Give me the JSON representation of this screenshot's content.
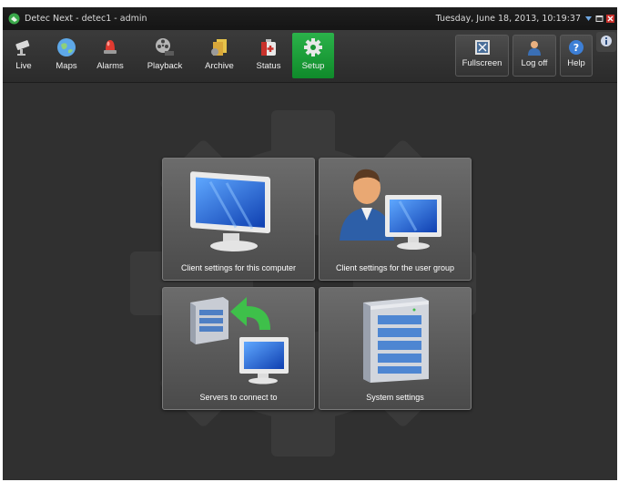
{
  "titlebar": {
    "title": "Detec Next - detec1 - admin",
    "datetime": "Tuesday, June 18, 2013, 10:19:37"
  },
  "toolbar": {
    "nav": [
      {
        "label": "Live",
        "icon": "camera-icon"
      },
      {
        "label": "Maps",
        "icon": "globe-icon"
      },
      {
        "label": "Alarms",
        "icon": "alarm-siren-icon"
      },
      {
        "label": "Playback",
        "icon": "film-reel-icon"
      },
      {
        "label": "Archive",
        "icon": "archive-folders-icon"
      },
      {
        "label": "Status",
        "icon": "first-aid-kit-icon"
      },
      {
        "label": "Setup",
        "icon": "gear-icon",
        "active": true
      }
    ],
    "right": [
      {
        "label": "Fullscreen",
        "icon": "fullscreen-icon"
      },
      {
        "label": "Log off",
        "icon": "user-icon"
      },
      {
        "label": "Help",
        "icon": "help-icon"
      }
    ]
  },
  "tiles": [
    {
      "label": "Client settings for this computer",
      "icon": "monitor-icon"
    },
    {
      "label": "Client settings for the user group",
      "icon": "user-group-monitor-icon"
    },
    {
      "label": "Servers to connect to",
      "icon": "server-connect-icon"
    },
    {
      "label": "System settings",
      "icon": "server-tower-icon"
    }
  ],
  "colors": {
    "active_tab": "#16952f",
    "background": "#303030",
    "tile": "#5e5e5e"
  }
}
